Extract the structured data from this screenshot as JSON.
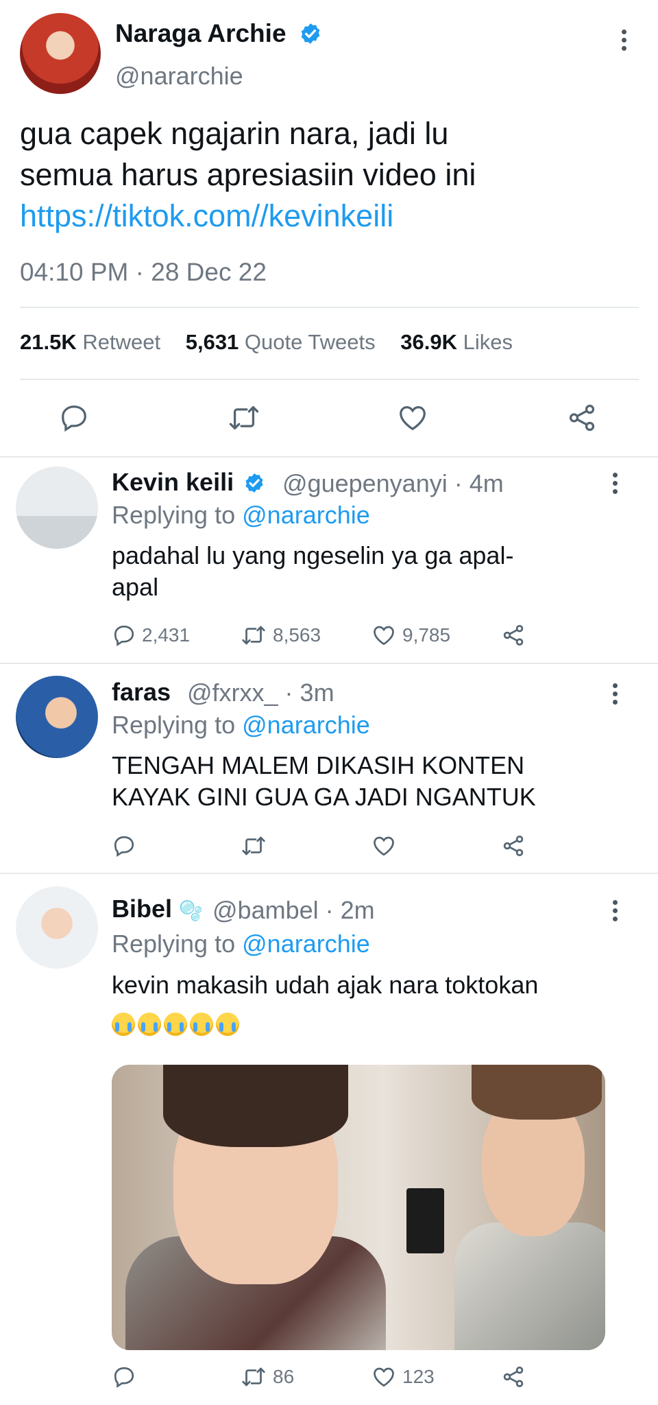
{
  "main_tweet": {
    "author_name": "Naraga Archie",
    "author_handle": "@nararchie",
    "text_lines": [
      "gua capek ngajarin nara, jadi lu",
      "semua harus apresiasiin video ini"
    ],
    "link": "https://tiktok.com//kevinkeili",
    "timestamp": "04:10 PM · 28 Dec 22",
    "stats": {
      "retweets_value": "21.5K",
      "retweets_label": "Retweet",
      "quotes_value": "5,631",
      "quotes_label": "Quote Tweets",
      "likes_value": "36.9K",
      "likes_label": "Likes"
    }
  },
  "replies": [
    {
      "name": "Kevin keili",
      "handle_time": "@guepenyanyi · 4m",
      "replying_prefix": "Replying to",
      "replying_to": "@nararchie",
      "text_lines": [
        "padahal lu yang ngeselin ya ga apal-",
        "apal"
      ],
      "reply_count": "2,431",
      "retweet_count": "8,563",
      "like_count": "9,785"
    },
    {
      "name": "faras",
      "handle_time": "@fxrxx_ · 3m",
      "replying_prefix": "Replying to",
      "replying_to": "@nararchie",
      "text_lines": [
        "TENGAH MALEM DIKASIH KONTEN",
        "KAYAK GINI GUA GA JADI NGANTUK"
      ]
    },
    {
      "name": "Bibel",
      "name_suffix": "🫧",
      "handle_time": "@bambel · 2m",
      "replying_prefix": "Replying to",
      "replying_to": "@nararchie",
      "text_lines": [
        "kevin makasih udah ajak nara toktokan"
      ],
      "retweet_count": "86",
      "like_count": "123"
    }
  ],
  "icons": [
    "reply-icon",
    "retweet-icon",
    "like-icon",
    "share-icon",
    "verified-badge-icon",
    "more-options-icon"
  ],
  "colors": {
    "link": "#1d9bf0",
    "verified": "#1d9bf0",
    "muted": "#6e7781",
    "text": "#0f1419"
  }
}
